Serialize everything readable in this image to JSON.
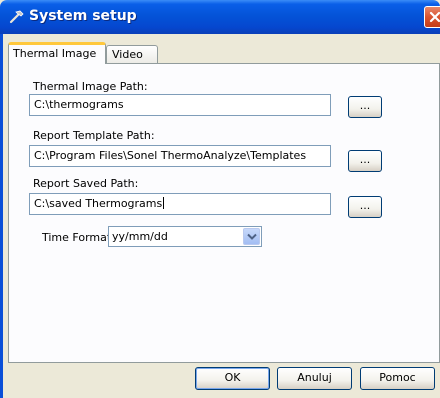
{
  "window": {
    "title": "System setup",
    "title_icon": "hammer-icon",
    "close_icon": "close-icon"
  },
  "tabs": [
    {
      "label": "Thermal Image",
      "active": true
    },
    {
      "label": "Video",
      "active": false
    }
  ],
  "fields": {
    "thermal_image_path": {
      "label": "Thermal Image Path:",
      "value": "C:\\thermograms",
      "browse_label": "..."
    },
    "report_template_path": {
      "label": "Report Template Path:",
      "value": "C:\\Program Files\\Sonel ThermoAnalyze\\Templates",
      "browse_label": "..."
    },
    "report_saved_path": {
      "label": "Report Saved Path:",
      "value": "C:\\saved Thermograms",
      "browse_label": "..."
    },
    "time_format": {
      "label": "Time Format",
      "selected": "yy/mm/dd"
    }
  },
  "buttons": {
    "ok": "OK",
    "cancel": "Anuluj",
    "help": "Pomoc"
  },
  "colors": {
    "titlebar": "#0453d8",
    "dialog_bg": "#ece9d8",
    "tab_highlight": "#ffc83c",
    "close_button": "#d9532f"
  }
}
